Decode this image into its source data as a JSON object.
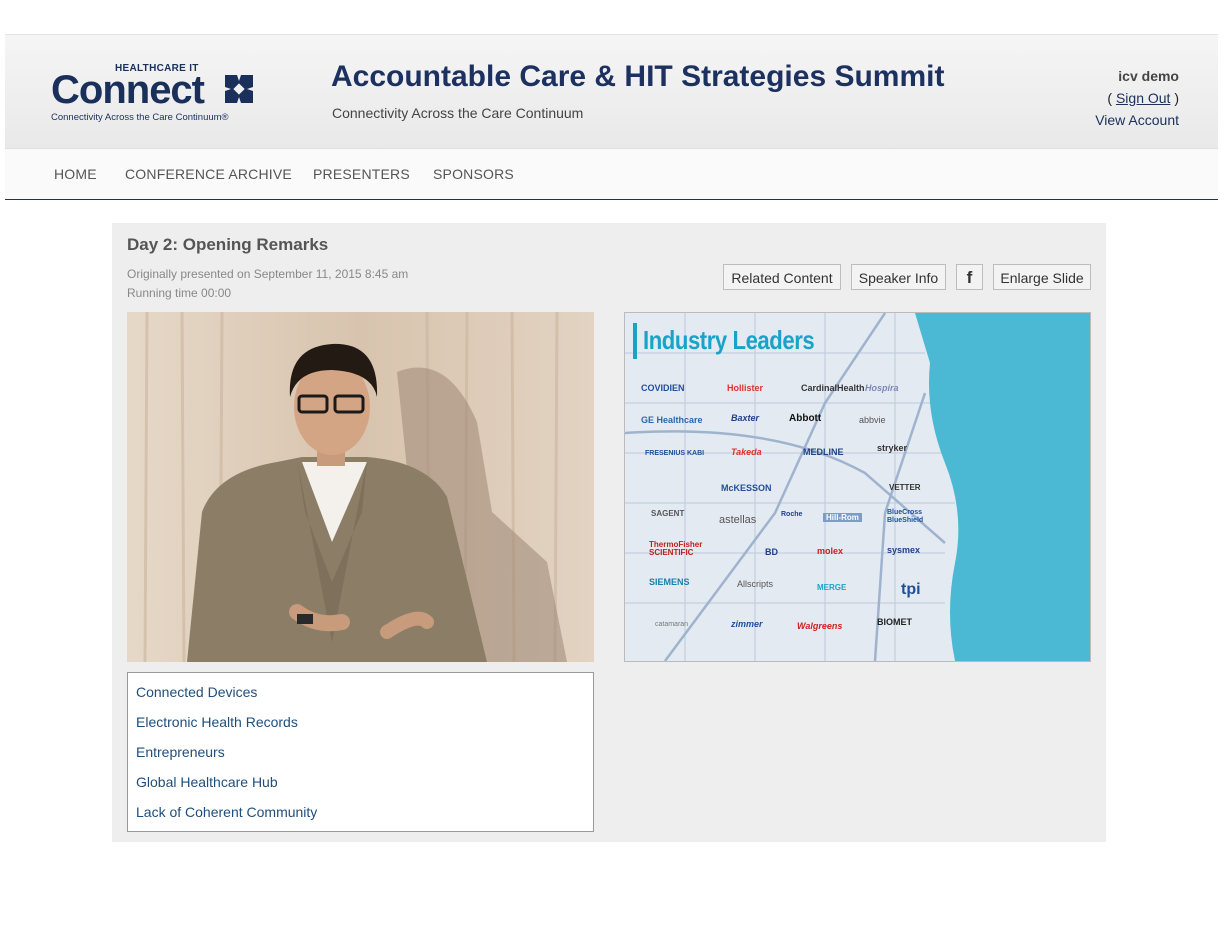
{
  "brand": {
    "small": "HEALTHCARE IT",
    "big": "Connect",
    "tagline": "Connectivity Across the Care Continuum®"
  },
  "site": {
    "title": "Accountable Care & HIT Strategies Summit",
    "subtitle": "Connectivity Across the Care Continuum"
  },
  "account": {
    "username": "icv demo",
    "open_paren": "(",
    "sign_out": "Sign Out",
    "close_paren": ")",
    "view_account": "View Account"
  },
  "nav": [
    "HOME",
    "CONFERENCE ARCHIVE",
    "PRESENTERS",
    "SPONSORS"
  ],
  "session": {
    "title": "Day 2: Opening Remarks",
    "presented": "Originally presented on September 11, 2015 8:45 am",
    "running_time": "Running time 00:00"
  },
  "actions": {
    "related": "Related Content",
    "speaker": "Speaker Info",
    "facebook_icon": "f",
    "enlarge": "Enlarge Slide"
  },
  "slide": {
    "title": "Industry Leaders",
    "logos": [
      "COVIDIEN",
      "Hollister",
      "CardinalHealth",
      "Hospira",
      "GE Healthcare",
      "Baxter",
      "Abbott",
      "abbvie",
      "FRESENIUS KABI",
      "Takeda",
      "MEDLINE",
      "stryker",
      "McKESSON",
      "VETTER",
      "SAGENT",
      "astellas",
      "Roche",
      "Hill-Rom",
      "BlueCross BlueShield",
      "ThermoFisher SCIENTIFIC",
      "BD",
      "molex",
      "sysmex",
      "SIEMENS",
      "Allscripts",
      "MERGE",
      "tpi",
      "catamaran",
      "zimmer",
      "Walgreens",
      "BIOMET"
    ]
  },
  "tags": [
    "Connected Devices",
    "Electronic Health Records",
    "Entrepreneurs",
    "Global Healthcare Hub",
    "Lack of Coherent Community"
  ],
  "colors": {
    "navy": "#1d3160",
    "link": "#1f4e7a",
    "accent": "#1aa3c9",
    "water": "#4bb9d4"
  }
}
